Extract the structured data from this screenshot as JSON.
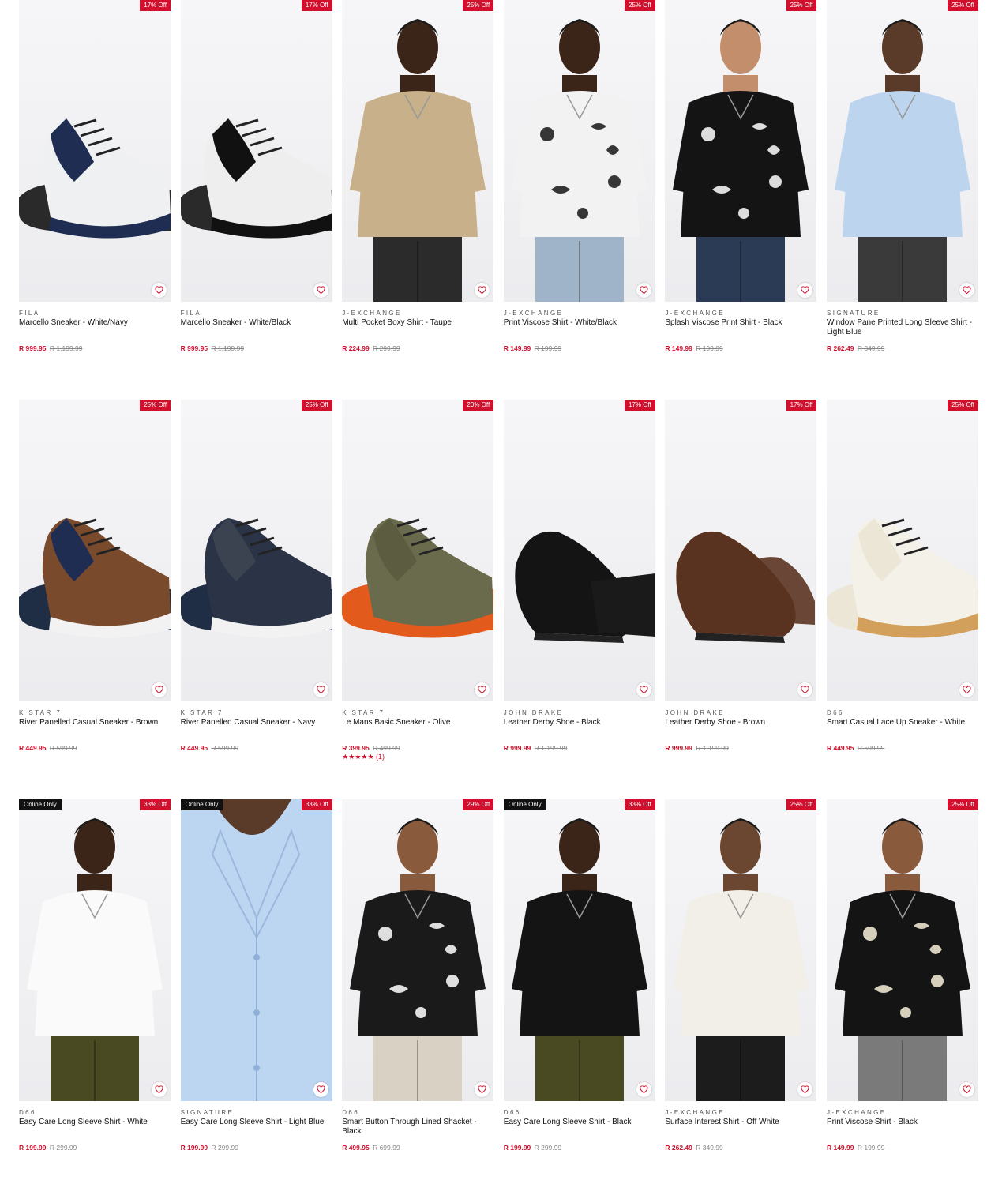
{
  "colors": {
    "accent": "#d0102d",
    "online_badge": "#111111"
  },
  "products": [
    {
      "brand": "FILA",
      "name": "Marcello Sneaker - White/Navy",
      "price": "R 999.95",
      "was": "R 1,199.99",
      "discount": "17% Off",
      "image": "sneaker-navy"
    },
    {
      "brand": "FILA",
      "name": "Marcello Sneaker - White/Black",
      "price": "R 999.95",
      "was": "R 1,199.99",
      "discount": "17% Off",
      "image": "sneaker-black"
    },
    {
      "brand": "J-EXCHANGE",
      "name": "Multi Pocket Boxy Shirt - Taupe",
      "price": "R 224.99",
      "was": "R 299.99",
      "discount": "25% Off",
      "image": "shirt-taupe"
    },
    {
      "brand": "J-EXCHANGE",
      "name": "Print Viscose Shirt - White/Black",
      "price": "R 149.99",
      "was": "R 199.99",
      "discount": "25% Off",
      "image": "shirt-print-white"
    },
    {
      "brand": "J-EXCHANGE",
      "name": "Splash Viscose Print Shirt - Black",
      "price": "R 149.99",
      "was": "R 199.99",
      "discount": "25% Off",
      "image": "shirt-splash-black"
    },
    {
      "brand": "SIGNATURE",
      "name": "Window Pane Printed Long Sleeve Shirt - Light Blue",
      "price": "R 262.49",
      "was": "R 349.99",
      "discount": "25% Off",
      "image": "shirt-light-blue"
    },
    {
      "brand": "K STAR 7",
      "name": "River Panelled Casual Sneaker - Brown",
      "price": "R 449.95",
      "was": "R 599.99",
      "discount": "25% Off",
      "image": "sneaker-brown"
    },
    {
      "brand": "K STAR 7",
      "name": "River Panelled Casual Sneaker - Navy",
      "price": "R 449.95",
      "was": "R 599.99",
      "discount": "25% Off",
      "image": "sneaker-navy-dark"
    },
    {
      "brand": "K STAR 7",
      "name": "Le Mans Basic Sneaker - Olive",
      "price": "R 399.95",
      "was": "R 499.99",
      "discount": "20% Off",
      "image": "sneaker-olive",
      "rating_stars": "★★★★★",
      "rating_count": "(1)"
    },
    {
      "brand": "JOHN DRAKE",
      "name": "Leather Derby Shoe - Black",
      "price": "R 999.99",
      "was": "R 1,199.99",
      "discount": "17% Off",
      "image": "derby-black"
    },
    {
      "brand": "JOHN DRAKE",
      "name": "Leather Derby Shoe - Brown",
      "price": "R 999.99",
      "was": "R 1,199.99",
      "discount": "17% Off",
      "image": "derby-brown"
    },
    {
      "brand": "D66",
      "name": "Smart Casual Lace Up Sneaker - White",
      "price": "R 449.95",
      "was": "R 599.99",
      "discount": "25% Off",
      "image": "sneaker-white"
    },
    {
      "brand": "D66",
      "name": "Easy Care Long Sleeve Shirt - White",
      "price": "R 199.99",
      "was": "R 299.99",
      "discount": "33% Off",
      "online": "Online Only",
      "image": "shirt-white-ls"
    },
    {
      "brand": "SIGNATURE",
      "name": "Easy Care Long Sleeve Shirt - Light Blue",
      "price": "R 199.99",
      "was": "R 299.99",
      "discount": "33% Off",
      "online": "Online Only",
      "image": "shirt-blue-closeup"
    },
    {
      "brand": "D66",
      "name": "Smart Button Through Lined Shacket - Black",
      "price": "R 499.95",
      "was": "R 699.99",
      "discount": "29% Off",
      "image": "shacket-black"
    },
    {
      "brand": "D66",
      "name": "Easy Care Long Sleeve Shirt - Black",
      "price": "R 199.99",
      "was": "R 299.99",
      "discount": "33% Off",
      "online": "Online Only",
      "image": "shirt-black-ls"
    },
    {
      "brand": "J-EXCHANGE",
      "name": "Surface Interest Shirt - Off White",
      "price": "R 262.49",
      "was": "R 349.99",
      "discount": "25% Off",
      "image": "shirt-offwhite"
    },
    {
      "brand": "J-EXCHANGE",
      "name": "Print Viscose Shirt - Black",
      "price": "R 149.99",
      "was": "R 199.99",
      "discount": "25% Off",
      "image": "shirt-print-black"
    }
  ]
}
